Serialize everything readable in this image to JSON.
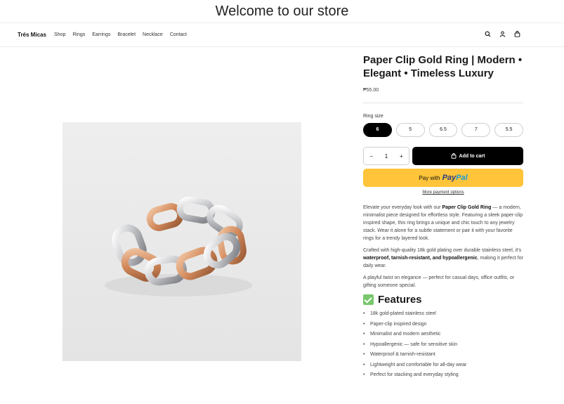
{
  "announcement": "Welcome to our store",
  "header": {
    "brand": "Trés Micas",
    "nav": [
      "Shop",
      "Rings",
      "Earrings",
      "Bracelet",
      "Necklace",
      "Contact"
    ],
    "icons": [
      "search-icon",
      "account-icon",
      "cart-icon"
    ]
  },
  "product": {
    "title": "Paper Clip Gold Ring | Modern • Elegant • Timeless Luxury",
    "price": "₱55.00",
    "size_label": "Ring size",
    "sizes": [
      "6",
      "5",
      "6.5",
      "7",
      "5.5"
    ],
    "selected_size": "6",
    "quantity": "1",
    "qty_minus": "−",
    "qty_plus": "+",
    "add_to_cart": "Add to cart",
    "paypal_prefix": "Pay with",
    "paypal_brand_1": "Pay",
    "paypal_brand_2": "Pal",
    "more_payment": "More payment options",
    "description": {
      "p1_before": "Elevate your everyday look with our ",
      "p1_bold": "Paper Clip Gold Ring",
      "p1_after": " — a modern, minimalist piece designed for effortless style. Featuring a sleek paper-clip inspired shape, this ring brings a unique and chic touch to any jewelry stack. Wear it alone for a subtle statement or pair it with your favorite rings for a trendy layered look.",
      "p2_before": "Crafted with high-quality 18k gold plating over durable stainless steel, it's ",
      "p2_bold": "waterproof, tarnish-resistant, and hypoallergenic",
      "p2_after": ", making it perfect for daily wear.",
      "p3": "A playful twist on elegance — perfect for casual days, office outfits, or gifting someone special."
    },
    "features_title": "Features",
    "features": [
      "18k gold-plated stainless steel",
      "Paper-clip inspired design",
      "Minimalist and modern aesthetic",
      "Hypoallergenic — safe for sensitive skin",
      "Waterproof & tarnish-resistant",
      "Lightweight and comfortable for all-day wear",
      "Perfect for stacking and everyday styling"
    ]
  },
  "colors": {
    "paypal_yellow": "#ffc439",
    "primary_button": "#000000",
    "rose_gold": "#d9956b",
    "silver": "#c8c8cc"
  }
}
